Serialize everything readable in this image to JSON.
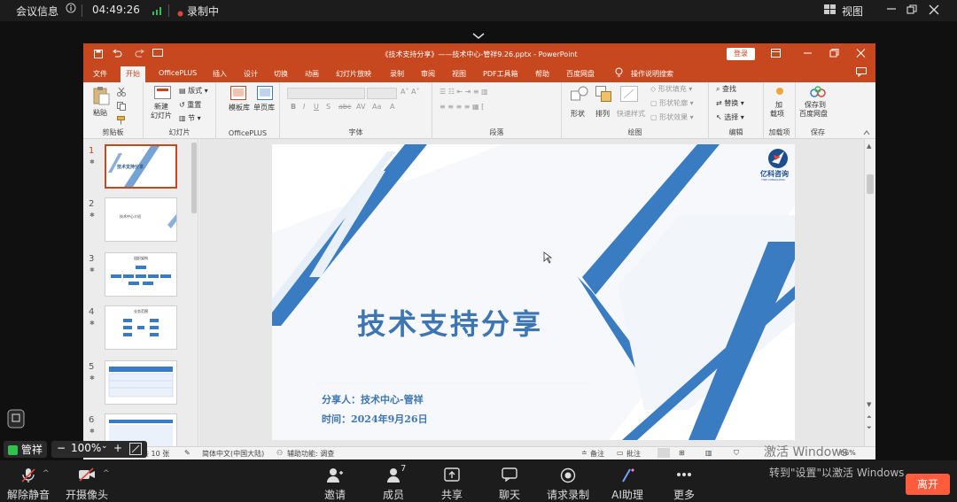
{
  "topbar": {
    "meeting_info": "会议信息",
    "info_icon": "info-icon",
    "time": "04:49:26",
    "recording": "录制中",
    "view": "视图"
  },
  "ppt": {
    "title": "《技术支持分享》——技术中心-管祥9.26.pptx - PowerPoint",
    "login": "登录",
    "tabs": [
      "文件",
      "开始",
      "OfficePLUS",
      "插入",
      "设计",
      "切换",
      "动画",
      "幻灯片放映",
      "录制",
      "审阅",
      "视图",
      "PDF工具箱",
      "帮助",
      "百度网盘",
      "操作说明搜索"
    ],
    "active_tab": "开始",
    "ribbon": {
      "paste": "粘贴",
      "clipboard": "剪贴板",
      "new_slide_1": "新建",
      "new_slide_2": "幻灯片",
      "layout": "版式",
      "reset": "重置",
      "section": "节",
      "slides": "幻灯片",
      "template_lib": "模板库",
      "single_page_lib": "单页库",
      "officeplus": "OfficePLUS",
      "font": "字体",
      "paragraph": "段落",
      "shape": "形状",
      "arrange": "排列",
      "quick_style": "快速样式",
      "shape_fill": "形状填充",
      "shape_outline": "形状轮廓",
      "shape_effect": "形状效果",
      "drawing": "绘图",
      "find": "查找",
      "replace": "替换",
      "select": "选择",
      "editing": "编辑",
      "addin_1": "加",
      "addin_2": "载项",
      "addins": "加载项",
      "save_baidu_1": "保存到",
      "save_baidu_2": "百度网盘",
      "save": "保存"
    },
    "thumbnails": [
      {
        "num": "1",
        "text": "技术支持分享"
      },
      {
        "num": "2",
        "text": "技术中心介绍"
      },
      {
        "num": "3",
        "text": "组织架构"
      },
      {
        "num": "4",
        "text": "业务范围"
      },
      {
        "num": "5",
        "text": ""
      },
      {
        "num": "6",
        "text": ""
      }
    ],
    "slide": {
      "title": "技术支持分享",
      "sharer": "分享人：技术中心-管祥",
      "date": "时间：2024年9月26日",
      "logo_text": "亿科咨询",
      "logo_sub": "YIKE CONSULTING"
    },
    "status": {
      "slide_count": "共 10 张",
      "language": "简体中文(中国大陆)",
      "accessibility": "辅助功能: 调查",
      "notes": "备注",
      "comments": "批注",
      "zoom": "66%"
    }
  },
  "meeting": {
    "name": "管祥",
    "zoom": "100%",
    "buttons": {
      "unmute": "解除静音",
      "camera": "开摄像头",
      "invite": "邀请",
      "members": "成员",
      "members_count": "7",
      "share": "共享",
      "chat": "聊天",
      "request_record": "请求录制",
      "ai": "AI助理",
      "more": "更多",
      "leave": "离开"
    },
    "watermark_1": "激活 Windows",
    "watermark_2": "转到\"设置\"以激活 Windows"
  },
  "colors": {
    "ppt_accent": "#c7471f",
    "slide_blue": "#3a7cc2",
    "leave_button": "#ff5b3c",
    "recording_dot": "#e0443a",
    "signal_green": "#2ec24f"
  }
}
